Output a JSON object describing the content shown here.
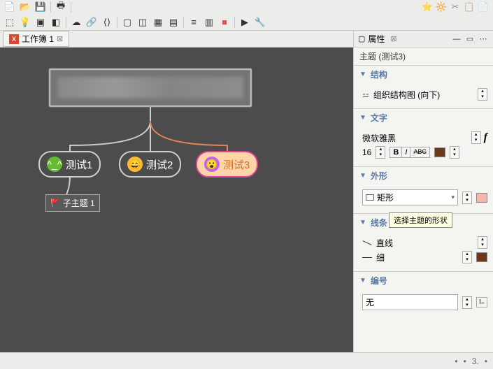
{
  "tab": {
    "label": "工作簿 1",
    "x_icon": "✕"
  },
  "canvas": {
    "node1": "测试1",
    "node2": "测试2",
    "node3": "测试3",
    "child1": "子主题 1"
  },
  "props": {
    "panel_title": "属性",
    "topic_label": "主题 (测试3)",
    "sections": {
      "structure": {
        "title": "结构",
        "value": "组织结构图 (向下)"
      },
      "text": {
        "title": "文字",
        "font": "微软雅黑",
        "size": "16",
        "bold": "B",
        "italic": "I",
        "strike": "ABC"
      },
      "shape": {
        "title": "外形",
        "value": "矩形"
      },
      "line": {
        "title": "线条",
        "tooltip": "选择主题的形状",
        "style": "直线",
        "weight": "细"
      },
      "number": {
        "title": "编号",
        "value": "无"
      }
    }
  },
  "footer": {
    "page": "3."
  }
}
